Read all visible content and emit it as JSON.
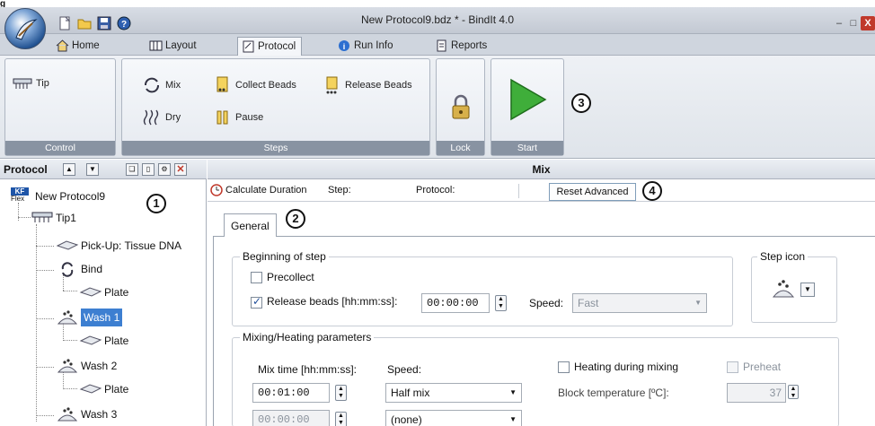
{
  "figure_label": "g",
  "window": {
    "title": "New Protocol9.bdz * - BindIt 4.0",
    "min_label": "–",
    "max_label": "□",
    "close_label": "X"
  },
  "quick_access": [
    "new-file-icon",
    "open-folder-icon",
    "save-icon",
    "help-icon"
  ],
  "ribbon_tabs": [
    {
      "label": "Home",
      "icon": "home-icon"
    },
    {
      "label": "Layout",
      "icon": "layout-icon"
    },
    {
      "label": "Protocol",
      "icon": "protocol-icon",
      "active": true
    },
    {
      "label": "Run Info",
      "icon": "info-icon"
    },
    {
      "label": "Reports",
      "icon": "report-icon"
    }
  ],
  "ribbon": {
    "control": {
      "label": "Control",
      "tip": "Tip"
    },
    "steps": {
      "label": "Steps",
      "mix": "Mix",
      "collect_beads": "Collect Beads",
      "release_beads": "Release Beads",
      "dry": "Dry",
      "pause": "Pause"
    },
    "lock": {
      "label": "Lock"
    },
    "start": {
      "label": "Start"
    }
  },
  "callouts": [
    "1",
    "2",
    "3",
    "4"
  ],
  "protocol_tree": {
    "header": "Protocol",
    "root": {
      "label": "New Protocol9",
      "badge_top": "KF",
      "badge_bottom": "Flex"
    },
    "nodes": [
      {
        "label": "Tip1"
      },
      {
        "label": "Pick-Up: Tissue DNA"
      },
      {
        "label": "Bind"
      },
      {
        "label": "Plate"
      },
      {
        "label": "Wash 1",
        "selected": true
      },
      {
        "label": "Plate"
      },
      {
        "label": "Wash 2"
      },
      {
        "label": "Plate"
      },
      {
        "label": "Wash 3"
      }
    ]
  },
  "mix_panel": {
    "title": "Mix",
    "toolbar": {
      "calculate_duration": "Calculate Duration",
      "step": "Step:",
      "protocol": "Protocol:",
      "reset_advanced": "Reset Advanced"
    },
    "tab_general": "General",
    "beginning_of_step": {
      "legend": "Beginning of step",
      "precollect": "Precollect",
      "precollect_checked": false,
      "release_beads": "Release beads [hh:mm:ss]:",
      "release_beads_checked": true,
      "release_time": "00:00:00",
      "speed_label": "Speed:",
      "speed_value": "Fast"
    },
    "step_icon": {
      "legend": "Step icon"
    },
    "mixing": {
      "legend": "Mixing/Heating parameters",
      "mix_time_label": "Mix time [hh:mm:ss]:",
      "speed_label": "Speed:",
      "rows": [
        {
          "time": "00:01:00",
          "speed": "Half mix"
        },
        {
          "time": "00:00:00",
          "speed": "(none)"
        }
      ],
      "heating_label": "Heating during mixing",
      "preheat_label": "Preheat",
      "block_temp_label": "Block temperature [ºC]:",
      "block_temp_value": "37"
    }
  }
}
